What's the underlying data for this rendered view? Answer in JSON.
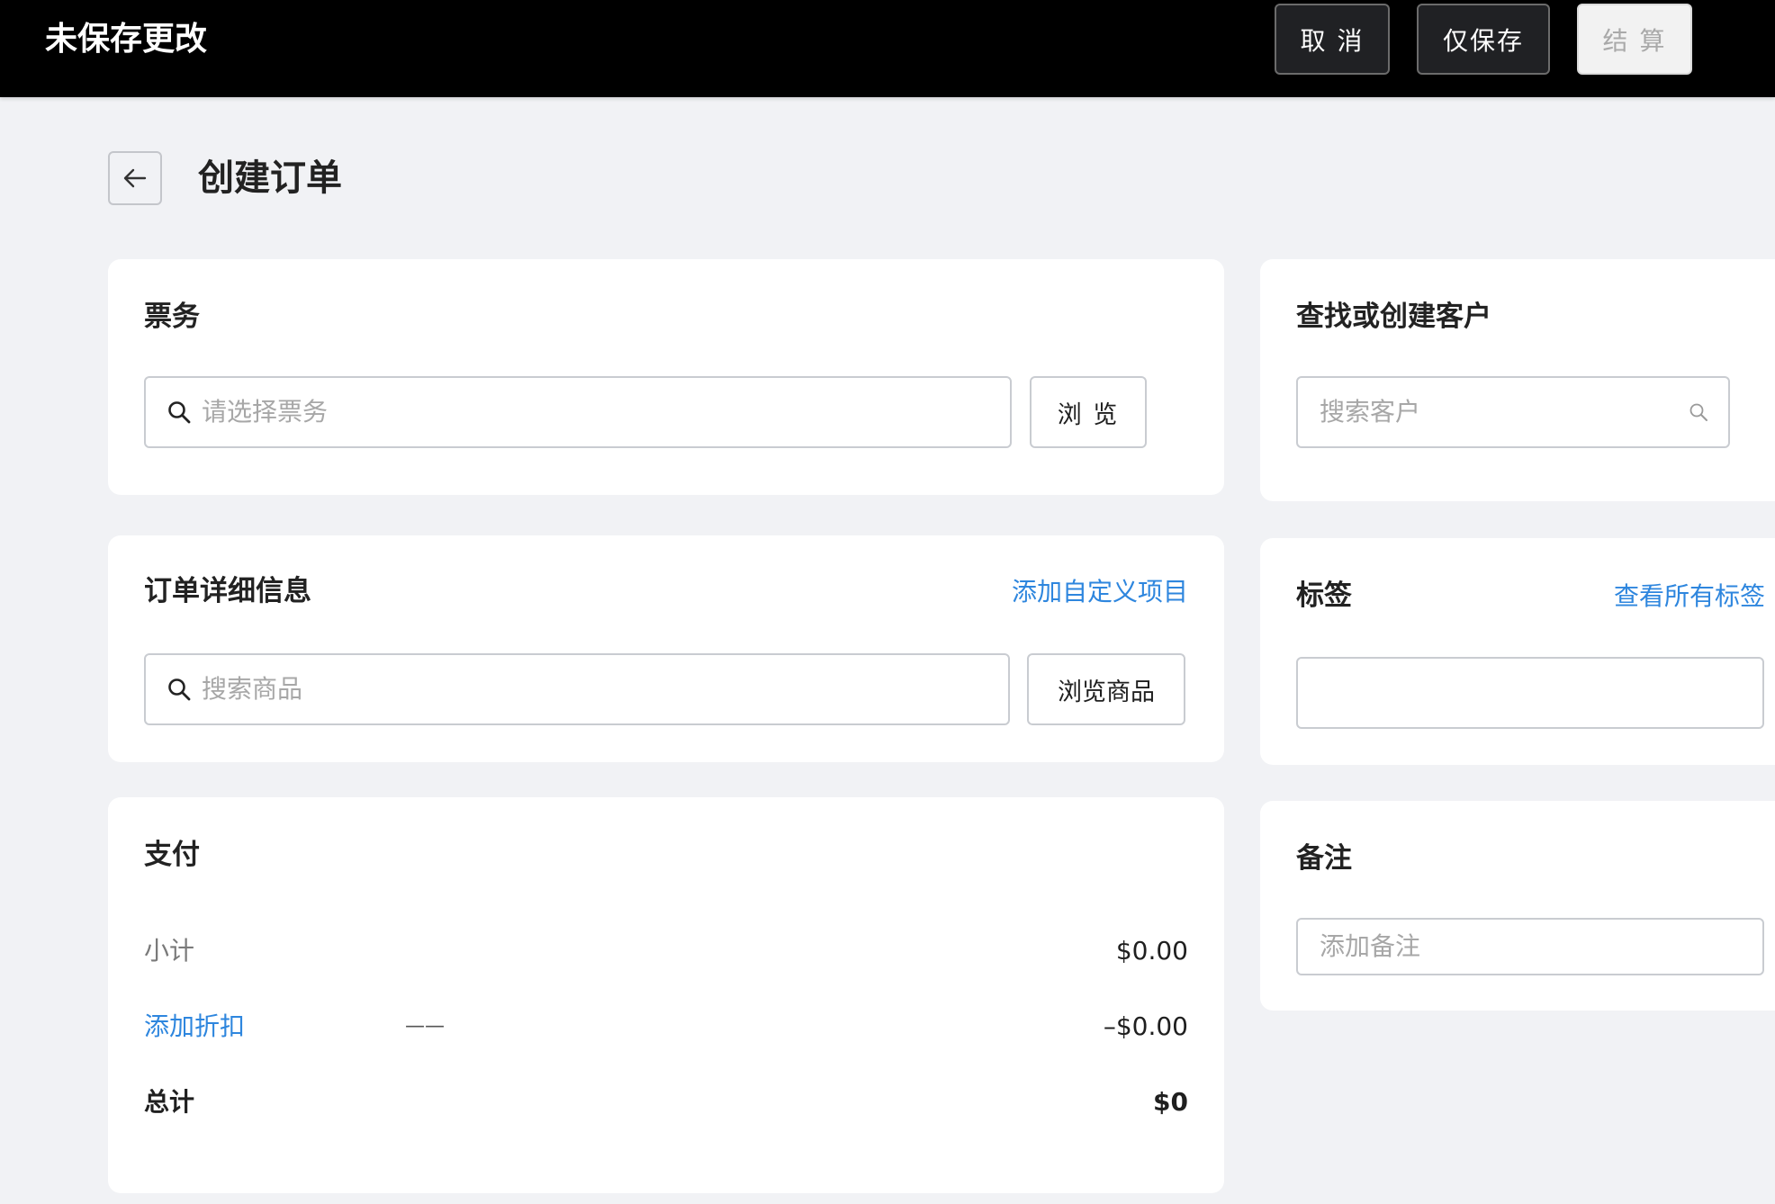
{
  "topbar": {
    "title": "未保存更改",
    "cancel_label": "取 消",
    "save_only_label": "仅保存",
    "checkout_label": "结 算"
  },
  "page": {
    "title": "创建订单"
  },
  "tickets": {
    "title": "票务",
    "search_placeholder": "请选择票务",
    "browse_label": "浏 览"
  },
  "order_details": {
    "title": "订单详细信息",
    "add_custom_label": "添加自定义项目",
    "search_placeholder": "搜索商品",
    "browse_label": "浏览商品"
  },
  "payment": {
    "title": "支付",
    "subtotal_label": "小计",
    "subtotal_value": "$0.00",
    "discount_label": "添加折扣",
    "discount_dash": "——",
    "discount_value": "–$0.00",
    "total_label": "总计",
    "total_value": "$0"
  },
  "customer": {
    "title": "查找或创建客户",
    "search_placeholder": "搜索客户"
  },
  "tags": {
    "title": "标签",
    "view_all_label": "查看所有标签",
    "value": ""
  },
  "notes": {
    "title": "备注",
    "placeholder": "添加备注"
  },
  "colors": {
    "topbar_bg": "#000000",
    "page_bg": "#f1f2f5",
    "link": "#2e86de"
  }
}
